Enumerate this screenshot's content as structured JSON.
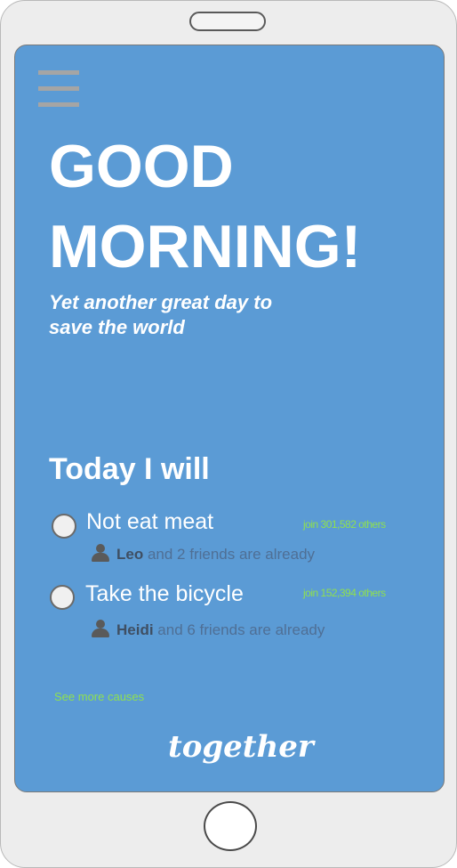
{
  "greeting": {
    "line1": "GOOD",
    "line2": "MORNING!"
  },
  "tagline": {
    "line1": "Yet another great day to",
    "line2": "save the world"
  },
  "section_title": "Today I will",
  "causes": [
    {
      "label": "Not eat meat",
      "join": "join 301,582 others",
      "friend_name": "Leo",
      "friends_text": " and 2 friends are already",
      "selected": false
    },
    {
      "label": "Take the bicycle",
      "join": "join 152,394 others",
      "friend_name": "Heidi",
      "friends_text": " and 6 friends are already",
      "selected": false
    }
  ],
  "see_more": "See more causes",
  "logo": "together",
  "icons": {
    "menu": "hamburger-menu-icon",
    "person": "person-icon"
  },
  "colors": {
    "screen_bg": "#5b9bd5",
    "accent_green": "#8fe04f",
    "text": "#ffffff"
  }
}
